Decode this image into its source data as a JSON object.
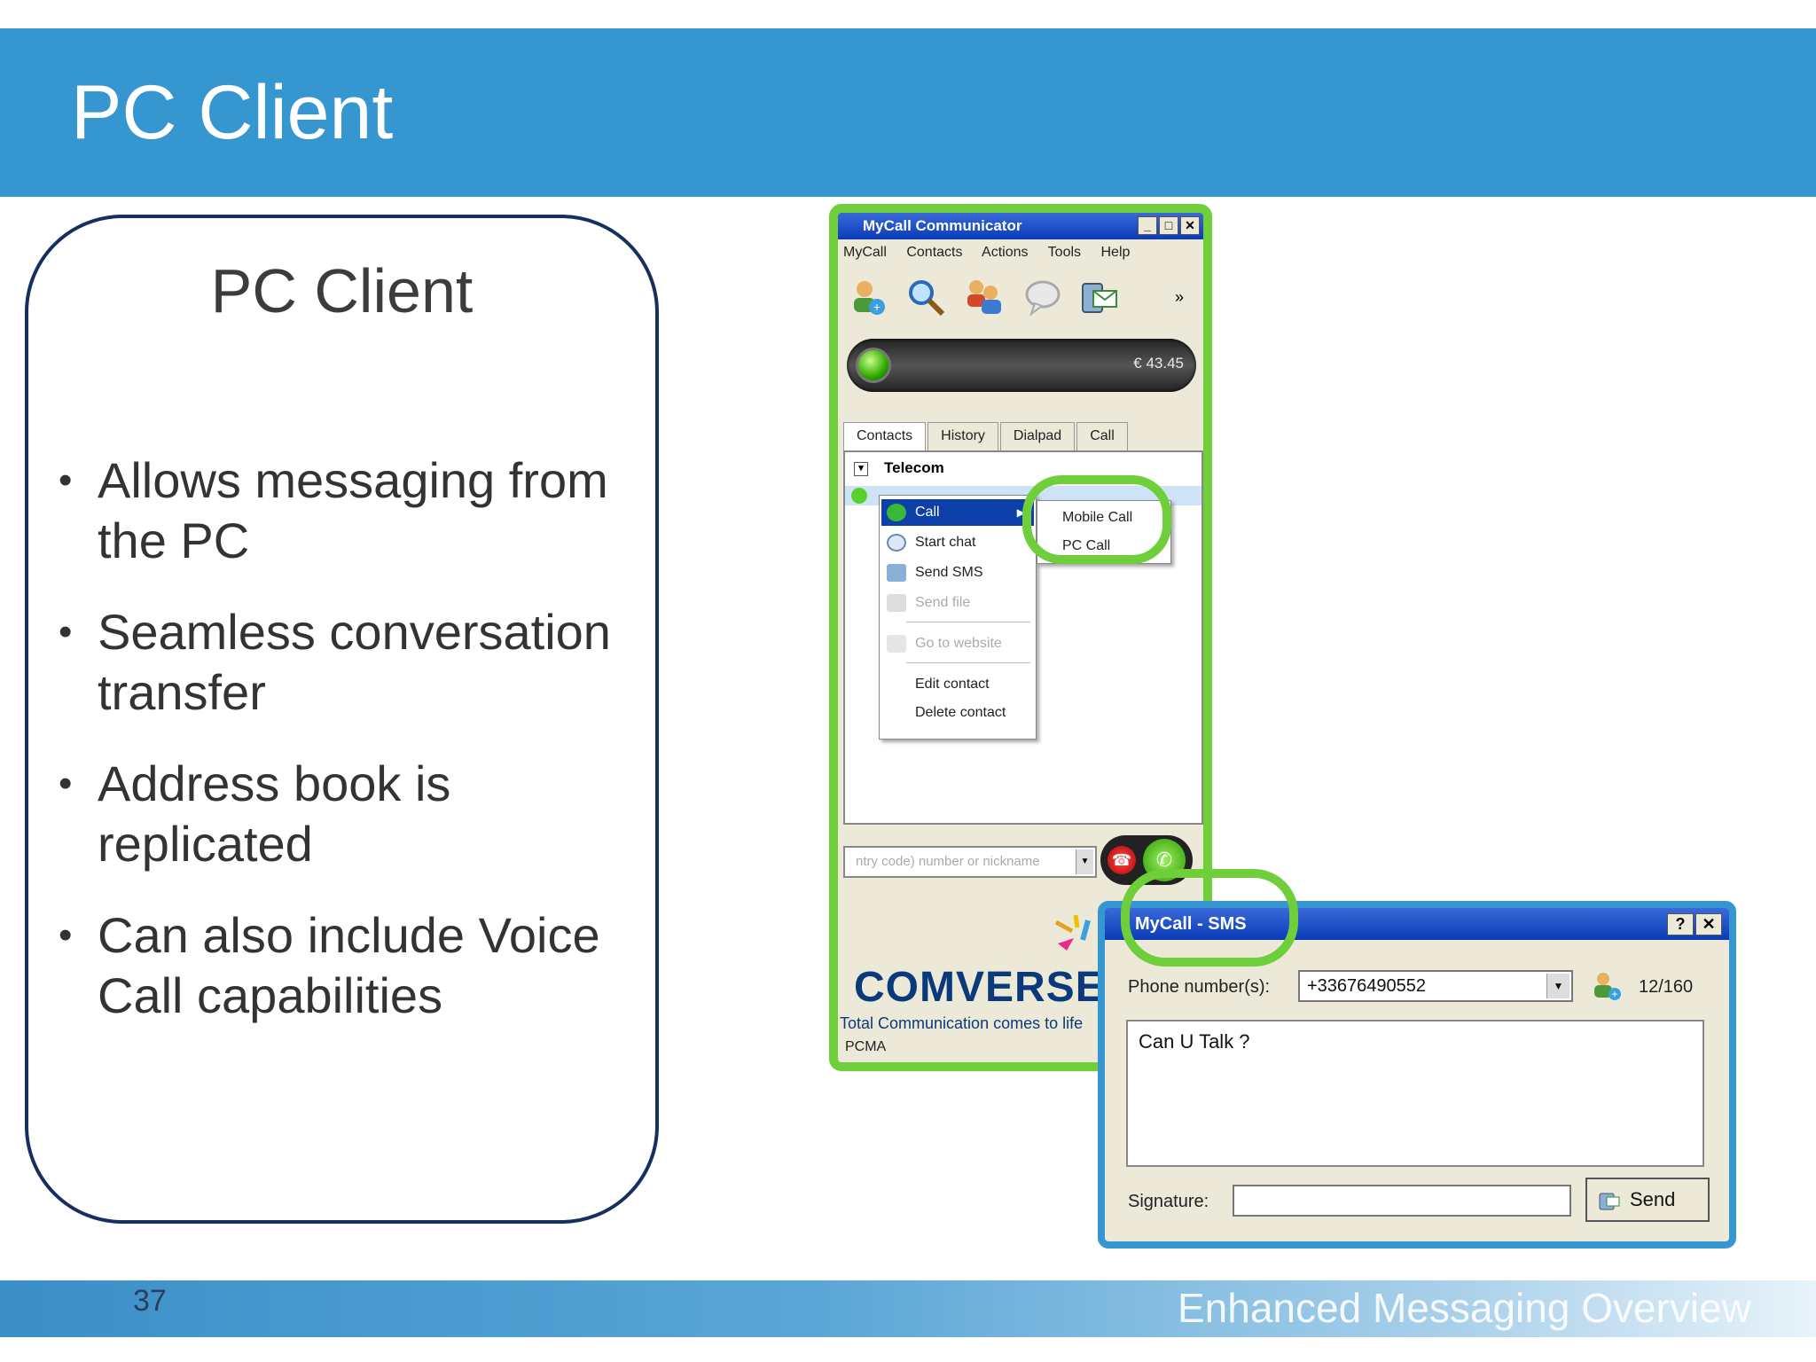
{
  "slide": {
    "title": "PC Client",
    "page_number": "37",
    "footer": "Enhanced Messaging Overview",
    "accent_color": "#3696cf",
    "highlight_color": "#6ecf3b"
  },
  "panel": {
    "title": "PC Client",
    "bullets": [
      "Allows messaging from the PC",
      "Seamless conversation transfer",
      "Address book is replicated",
      "Can also include Voice Call capabilities"
    ]
  },
  "communicator": {
    "title": "MyCall Communicator",
    "menu": [
      "MyCall",
      "Contacts",
      "Actions",
      "Tools",
      "Help"
    ],
    "toolbar_overflow": "»",
    "balance": "€ 43.45",
    "tabs": [
      "Contacts",
      "History",
      "Dialpad",
      "Call"
    ],
    "group": "Telecom",
    "context_menu": {
      "call": "Call",
      "start_chat": "Start chat",
      "send_sms": "Send SMS",
      "send_file": "Send file",
      "go_to_website": "Go to website",
      "edit_contact": "Edit contact",
      "delete_contact": "Delete contact"
    },
    "submenu": {
      "mobile_call": "Mobile Call",
      "pc_call": "PC Call"
    },
    "dial_placeholder": "ntry code) number or nickname",
    "logo": "COMVERSE",
    "tagline": "Total Communication comes to life",
    "codec": "PCMA"
  },
  "sms": {
    "title": "MyCall - SMS",
    "help_btn": "?",
    "close_btn": "✕",
    "phone_label": "Phone number(s):",
    "phone_value": "+33676490552",
    "counter": "12/160",
    "message": "Can U Talk ?",
    "signature_label": "Signature:",
    "signature_value": "",
    "send_label": "Send"
  }
}
